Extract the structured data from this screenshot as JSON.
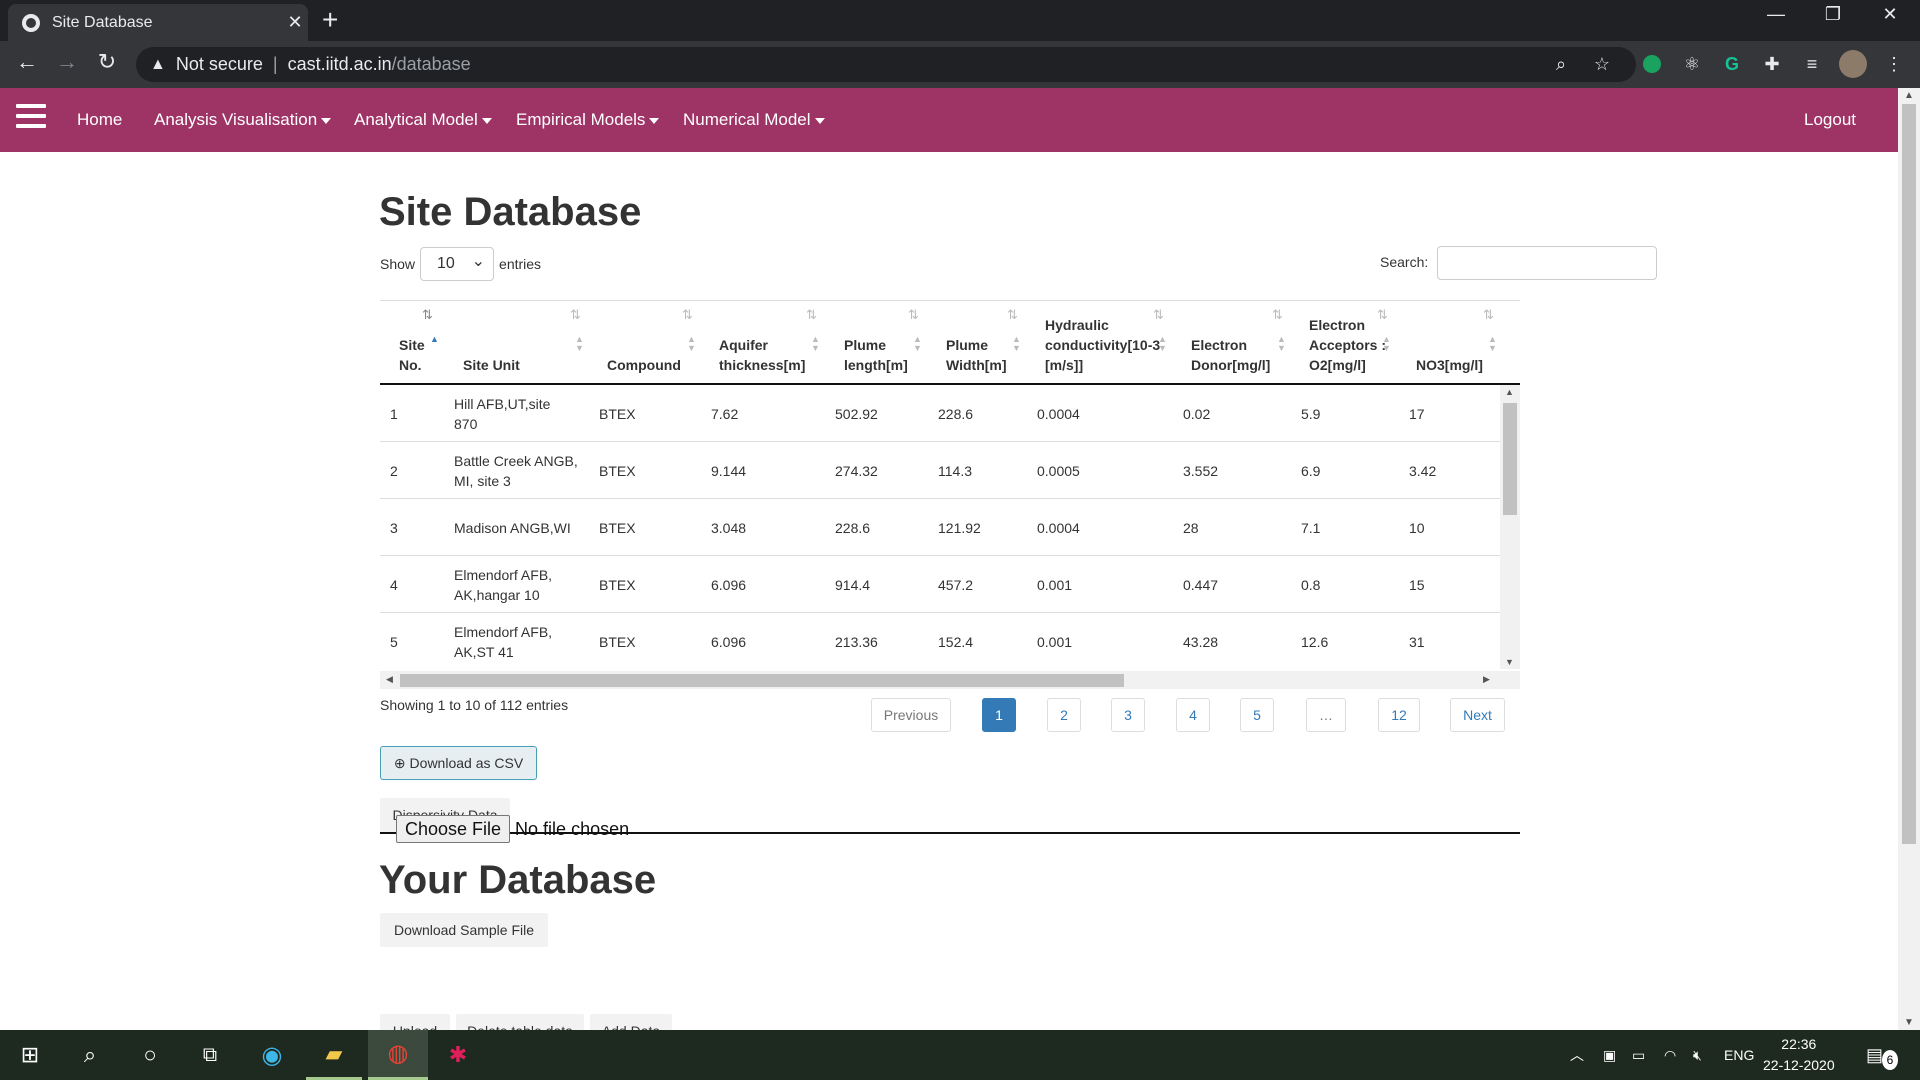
{
  "browser": {
    "tab_title": "Site Database",
    "close_label": "✕",
    "newtab_label": "+",
    "security_label": "Not secure",
    "url_host": "cast.iitd.ac.in",
    "url_path": "/database"
  },
  "nav": {
    "home": "Home",
    "analysis": "Analysis Visualisation",
    "analytical": "Analytical Model",
    "empirical": "Empirical Models",
    "numerical": "Numerical Model",
    "logout": "Logout"
  },
  "page": {
    "title": "Site Database",
    "show_label": "Show",
    "entries_value": "10",
    "entries_label": "entries",
    "search_label": "Search:",
    "info": "Showing 1 to 10 of 112 entries",
    "download_csv": "Download as CSV",
    "dispersivity": "Dispersivity Data",
    "your_db_title": "Your Database",
    "download_sample": "Download Sample File",
    "choose_file": "Choose File",
    "no_file": "No file chosen",
    "upload": "Upload",
    "delete_table": "Delete table data",
    "add_data": "Add Data"
  },
  "table": {
    "headers": [
      "Site No.",
      "Site Unit",
      "Compound",
      "Aquifer thickness[m]",
      "Plume length[m]",
      "Plume Width[m]",
      "Hydraulic conductivity[10-3 [m/s]]",
      "Electron Donor[mg/l]",
      "Electron Acceptors : O2[mg/l]",
      "NO3[mg/l]"
    ],
    "rows": [
      [
        "1",
        "Hill AFB,UT,site 870",
        "BTEX",
        "7.62",
        "502.92",
        "228.6",
        "0.0004",
        "0.02",
        "5.9",
        "17"
      ],
      [
        "2",
        "Battle Creek ANGB, MI, site 3",
        "BTEX",
        "9.144",
        "274.32",
        "114.3",
        "0.0005",
        "3.552",
        "6.9",
        "3.42"
      ],
      [
        "3",
        "Madison ANGB,WI",
        "BTEX",
        "3.048",
        "228.6",
        "121.92",
        "0.0004",
        "28",
        "7.1",
        "10"
      ],
      [
        "4",
        "Elmendorf AFB, AK,hangar 10",
        "BTEX",
        "6.096",
        "914.4",
        "457.2",
        "0.001",
        "0.447",
        "0.8",
        "15"
      ],
      [
        "5",
        "Elmendorf AFB, AK,ST 41",
        "BTEX",
        "6.096",
        "213.36",
        "152.4",
        "0.001",
        "43.28",
        "12.6",
        "31"
      ]
    ]
  },
  "pagination": {
    "previous": "Previous",
    "pages": [
      "1",
      "2",
      "3",
      "4",
      "5",
      "…",
      "12"
    ],
    "next": "Next",
    "active_page": "1"
  },
  "taskbar": {
    "lang": "ENG",
    "time": "22:36",
    "date": "22-12-2020",
    "notifications": "6"
  },
  "colors": {
    "nav_bg": "#9e3366",
    "active_page": "#337ab7"
  }
}
